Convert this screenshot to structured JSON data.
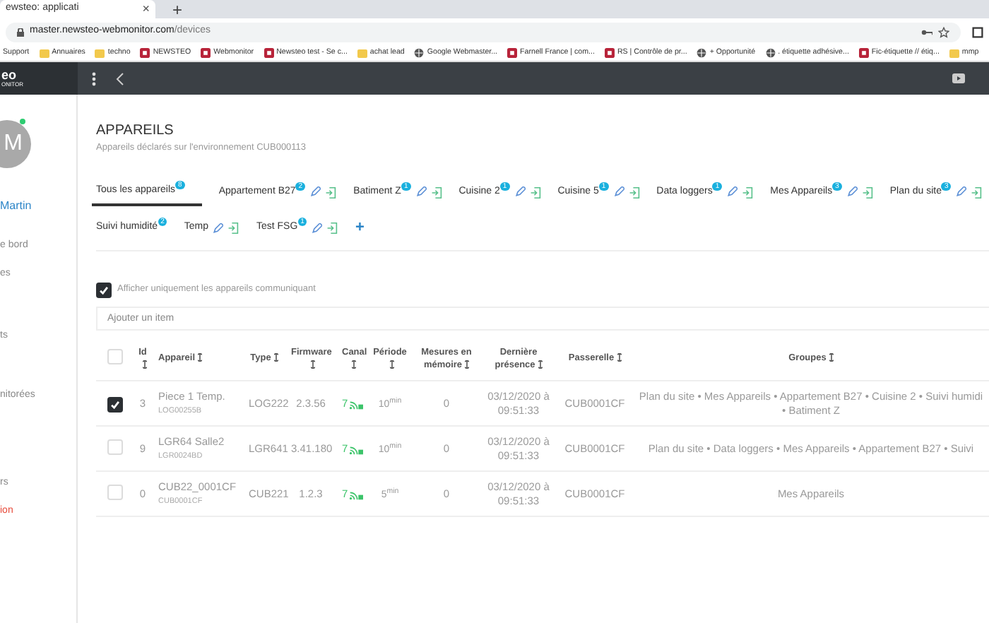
{
  "browser": {
    "tab_title": "ewsteo: applicati",
    "tab_close": "×",
    "new_tab": "+",
    "url_host": "master.newsteo-webmonitor.com",
    "url_path": "/devices",
    "bookmarks": [
      {
        "label": "Support",
        "kind": "text"
      },
      {
        "label": "Annuaires",
        "kind": "folder"
      },
      {
        "label": "techno",
        "kind": "folder"
      },
      {
        "label": "NEWSTEO",
        "kind": "site"
      },
      {
        "label": "Webmonitor",
        "kind": "site"
      },
      {
        "label": "Newsteo test - Se c...",
        "kind": "site"
      },
      {
        "label": "achat lead",
        "kind": "folder"
      },
      {
        "label": "Google Webmaster...",
        "kind": "globe"
      },
      {
        "label": "Farnell France | com...",
        "kind": "site"
      },
      {
        "label": "RS | Contrôle de pr...",
        "kind": "site"
      },
      {
        "label": "+ Opportunité",
        "kind": "globe"
      },
      {
        "label": ". étiquette adhésive...",
        "kind": "globe"
      },
      {
        "label": "Fic-étiquette // étiq...",
        "kind": "site"
      },
      {
        "label": "mmp",
        "kind": "folder"
      }
    ]
  },
  "header": {
    "logo_top": "eo",
    "logo_bottom": "ONITOR"
  },
  "sidebar": {
    "avatar": "M",
    "user": "Martin",
    "items": [
      {
        "label": "e bord",
        "kind": "normal"
      },
      {
        "label": "es",
        "kind": "normal"
      },
      {
        "label": "ts",
        "kind": "normal"
      },
      {
        "label": "nitorées",
        "kind": "normal"
      },
      {
        "label": "rs",
        "kind": "normal"
      },
      {
        "label": "ion",
        "kind": "danger"
      }
    ]
  },
  "page": {
    "title": "APPAREILS",
    "subtitle": "Appareils déclarés sur l'environnement CUB000113"
  },
  "tabs": [
    {
      "label": "Tous les appareils",
      "badge": "8",
      "selected": true,
      "kind": "all"
    },
    {
      "label": "Appartement B27",
      "badge": "2",
      "selected": false,
      "kind": "group"
    },
    {
      "label": "Batiment Z",
      "badge": "1",
      "selected": false,
      "kind": "group"
    },
    {
      "label": "Cuisine 2",
      "badge": "1",
      "selected": false,
      "kind": "group"
    },
    {
      "label": "Cuisine 5",
      "badge": "1",
      "selected": false,
      "kind": "group"
    },
    {
      "label": "Data loggers",
      "badge": "1",
      "selected": false,
      "kind": "group"
    },
    {
      "label": "Mes Appareils",
      "badge": "3",
      "selected": false,
      "kind": "group"
    },
    {
      "label": "Plan du site",
      "badge": "3",
      "selected": false,
      "kind": "group"
    },
    {
      "label": "Suivi humidité",
      "badge": "2",
      "selected": false,
      "kind": "clipped"
    },
    {
      "label": "Temp",
      "selected": false,
      "kind": "group"
    },
    {
      "label": "Test FSG",
      "badge": "1",
      "selected": false,
      "kind": "group"
    }
  ],
  "add_tab": "+",
  "filter": {
    "label": "Afficher uniquement les appareils communiquant",
    "checked": true
  },
  "add_item": {
    "placeholder": "Ajouter un item"
  },
  "table": {
    "select_all": {
      "checked": false
    },
    "columns": [
      "Id",
      "Appareil",
      "Type",
      "Firmware",
      "Canal",
      "Période",
      "Mesures en mémoire",
      "Dernière présence",
      "Passerelle",
      "Groupes"
    ],
    "rows": [
      {
        "checked": true,
        "id": "3",
        "name": "Piece 1 Temp.",
        "serial": "LOG00255B",
        "type": "LOG222",
        "firmware": "2.3.56",
        "canal": "7",
        "periode": "10$^{min}$",
        "mesures": "0",
        "presence": [
          "03/12/2020 à",
          "09:51:33"
        ],
        "passerelle": "CUB0001CF",
        "groupes": [
          "Plan du site • Mes Appareils • Appartement B27 • Cuisine 2 • Suivi humidi",
          "• Batiment Z"
        ]
      },
      {
        "checked": false,
        "id": "9",
        "name": "LGR64 Salle2",
        "serial": "LGR0024BD",
        "type": "LGR641",
        "firmware": "3.41.180",
        "canal": "7",
        "periode": "10$^{min}$",
        "mesures": "0",
        "presence": [
          "03/12/2020 à",
          "09:51:33"
        ],
        "passerelle": "CUB0001CF",
        "groupes": [
          "Plan du site • Data loggers • Mes Appareils • Appartement B27 • Suivi"
        ]
      },
      {
        "checked": false,
        "id": "0",
        "name": "CUB22_0001CF",
        "serial": "CUB0001CF",
        "type": "CUB221",
        "firmware": "1.2.3",
        "canal": "7",
        "periode": "5$^{min}$",
        "mesures": "0",
        "presence": [
          "03/12/2020 à",
          "09:51:33"
        ],
        "passerelle": "CUB0001CF",
        "groupes": [
          "Mes Appareils"
        ]
      }
    ]
  }
}
